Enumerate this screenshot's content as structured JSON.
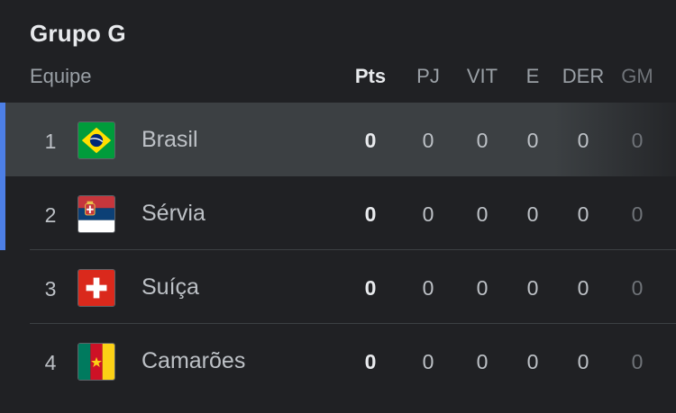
{
  "group_title": "Grupo G",
  "columns": {
    "team": "Equipe",
    "pts": "Pts",
    "pj": "PJ",
    "vit": "VIT",
    "e": "E",
    "der": "DER",
    "gm": "GM"
  },
  "teams": [
    {
      "pos": "1",
      "name": "Brasil",
      "flag_icon": "brazil-flag-icon",
      "pts": "0",
      "pj": "0",
      "vit": "0",
      "e": "0",
      "der": "0",
      "gm": "0"
    },
    {
      "pos": "2",
      "name": "Sérvia",
      "flag_icon": "serbia-flag-icon",
      "pts": "0",
      "pj": "0",
      "vit": "0",
      "e": "0",
      "der": "0",
      "gm": "0"
    },
    {
      "pos": "3",
      "name": "Suíça",
      "flag_icon": "switzerland-flag-icon",
      "pts": "0",
      "pj": "0",
      "vit": "0",
      "e": "0",
      "der": "0",
      "gm": "0"
    },
    {
      "pos": "4",
      "name": "Camarões",
      "flag_icon": "cameroon-flag-icon",
      "pts": "0",
      "pj": "0",
      "vit": "0",
      "e": "0",
      "der": "0",
      "gm": "0"
    }
  ],
  "colors": {
    "background": "#202124",
    "selected_row": "#3c4043",
    "qualify_accent": "#4d7fe6"
  }
}
